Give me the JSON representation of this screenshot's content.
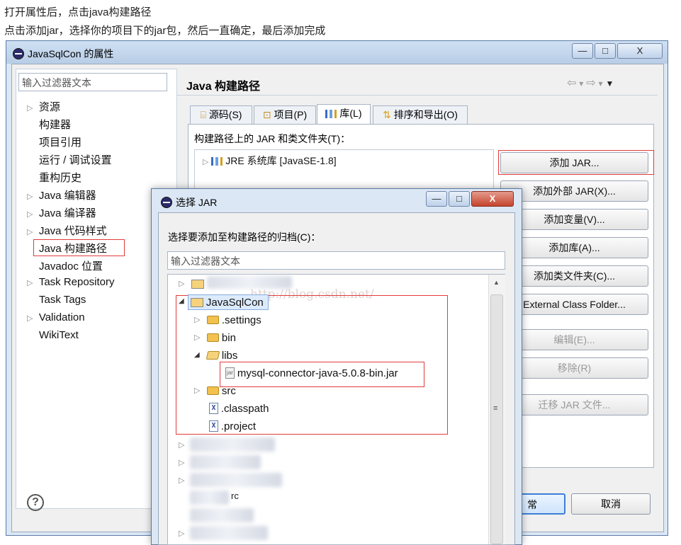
{
  "captions": [
    "打开属性后，点击java构建路径",
    "点击添加jar，选择你的项目下的jar包，然后一直确定，最后添加完成"
  ],
  "main_window": {
    "title": "JavaSqlCon 的属性",
    "min_glyph": "—",
    "max_glyph": "□",
    "close_glyph": "X",
    "filter_placeholder": "输入过滤器文本",
    "tree": [
      {
        "label": "资源",
        "expandable": true
      },
      {
        "label": "构建器",
        "expandable": false
      },
      {
        "label": "项目引用",
        "expandable": false
      },
      {
        "label": "运行 / 调试设置",
        "expandable": false
      },
      {
        "label": "重构历史",
        "expandable": false
      },
      {
        "label": "Java 编辑器",
        "expandable": true
      },
      {
        "label": "Java 编译器",
        "expandable": true
      },
      {
        "label": "Java 代码样式",
        "expandable": true
      },
      {
        "label": "Java 构建路径",
        "expandable": false,
        "selected": true
      },
      {
        "label": "Javadoc 位置",
        "expandable": false
      },
      {
        "label": "Task Repository",
        "expandable": true
      },
      {
        "label": "Task Tags",
        "expandable": false
      },
      {
        "label": "Validation",
        "expandable": true
      },
      {
        "label": "WikiText",
        "expandable": false
      }
    ],
    "page_title": "Java 构建路径",
    "tabs": [
      "源码(S)",
      "项目(P)",
      "库(L)",
      "排序和导出(O)"
    ],
    "active_tab": "库(L)",
    "panel_label": "构建路径上的 JAR 和类文件夹(T)：",
    "jre_entry": "JRE 系统库 [JavaSE-1.8]",
    "buttons": [
      "添加 JAR...",
      "添加外部 JAR(X)...",
      "添加变量(V)...",
      "添加库(A)...",
      "添加类文件夹(C)...",
      "External Class Folder...",
      "编辑(E)...",
      "移除(R)",
      "迁移 JAR 文件..."
    ],
    "ok_partial": "常",
    "cancel": "取消",
    "help_glyph": "?",
    "nav_glyphs": [
      "⇦",
      "▾",
      "⇨",
      "▾",
      "▼"
    ]
  },
  "jar_dialog": {
    "title": "选择 JAR",
    "prompt": "选择要添加至构建路径的归档(C)：",
    "filter_placeholder": "输入过滤器文本",
    "watermark": "http://blog.csdn.net/",
    "tree": {
      "project": "JavaSqlCon",
      "children": [
        ".settings",
        "bin",
        "libs",
        "mysql-connector-java-5.0.8-bin.jar",
        "src",
        ".classpath",
        ".project"
      ],
      "partial_blurred": "rc"
    }
  }
}
